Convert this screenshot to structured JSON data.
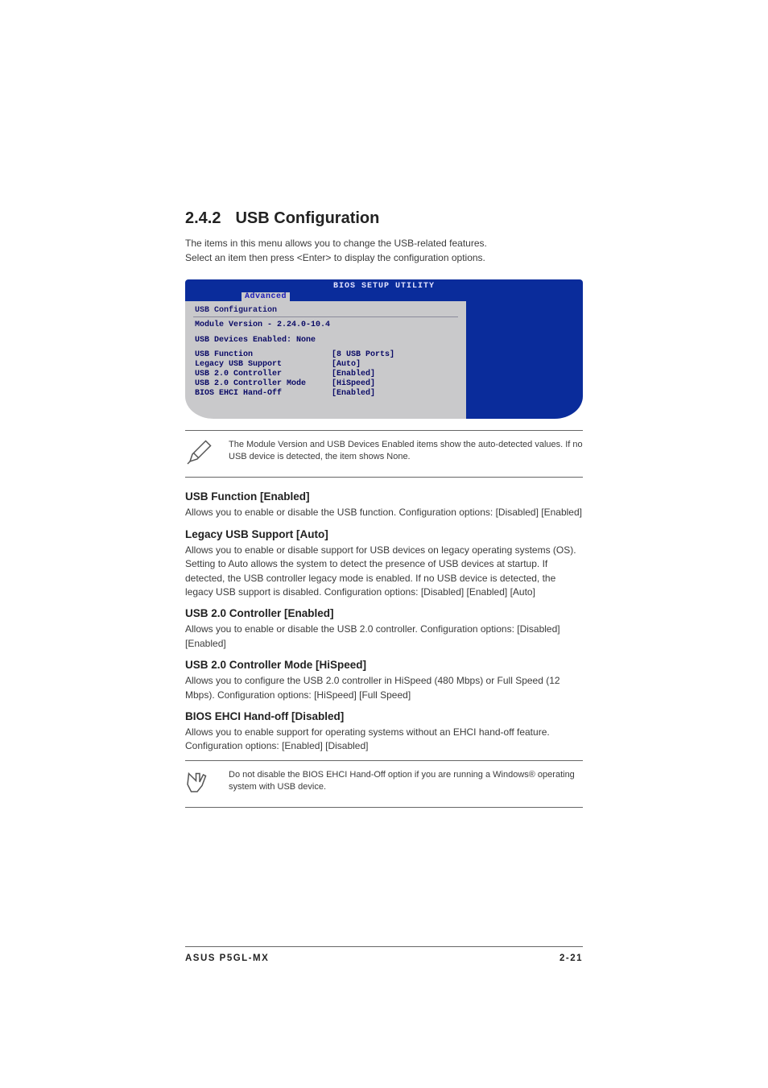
{
  "section": {
    "number": "2.4.2",
    "title": "USB Configuration"
  },
  "intro": {
    "line1": "The items in this menu allows you to change the USB-related features.",
    "line2": "Select an item then press <Enter> to display the configuration options."
  },
  "bios": {
    "title": "BIOS SETUP UTILITY",
    "tab": "Advanced",
    "panel_heading": "USB Configuration",
    "module_line": "Module Version - 2.24.0-10.4",
    "devices_line": "USB Devices Enabled: None",
    "rows": [
      {
        "label": "USB Function",
        "value": "[8 USB Ports]"
      },
      {
        "label": "Legacy USB Support",
        "value": "[Auto]"
      },
      {
        "label": "USB 2.0 Controller",
        "value": "[Enabled]"
      },
      {
        "label": "USB 2.0 Controller Mode",
        "value": "[HiSpeed]"
      },
      {
        "label": "BIOS EHCI Hand-Off",
        "value": "[Enabled]"
      }
    ]
  },
  "note1": "The Module Version and USB Devices Enabled items show the auto-detected values. If no USB device is detected, the item shows None.",
  "items": {
    "usb_function": {
      "heading": "USB Function [Enabled]",
      "body": "Allows you to enable or disable the USB function. Configuration options: [Disabled] [Enabled]"
    },
    "legacy": {
      "heading": "Legacy USB Support [Auto]",
      "body": "Allows you to enable or disable support for USB devices on legacy operating systems (OS). Setting to Auto allows the system to detect the presence of USB devices at startup. If detected, the USB controller legacy mode is enabled. If no USB device is detected, the legacy USB support is disabled. Configuration options: [Disabled] [Enabled] [Auto]"
    },
    "usb20": {
      "heading": "USB 2.0 Controller [Enabled]",
      "body": "Allows you to enable or disable the USB 2.0 controller. Configuration options: [Disabled] [Enabled]"
    },
    "usb20mode": {
      "heading": "USB 2.0 Controller Mode [HiSpeed]",
      "body": "Allows you to configure the USB 2.0 controller in HiSpeed (480 Mbps) or Full Speed (12 Mbps). Configuration options: [HiSpeed] [Full Speed]"
    },
    "ehci": {
      "heading": "BIOS EHCI Hand-off [Disabled]",
      "body": "Allows you to enable support for operating systems without an EHCI hand-off feature. Configuration options: [Enabled] [Disabled]"
    }
  },
  "note2": "Do not disable the BIOS EHCI Hand-Off option if you are running a Windows® operating system with USB device.",
  "footer": {
    "left": "ASUS P5GL-MX",
    "right": "2-21"
  }
}
